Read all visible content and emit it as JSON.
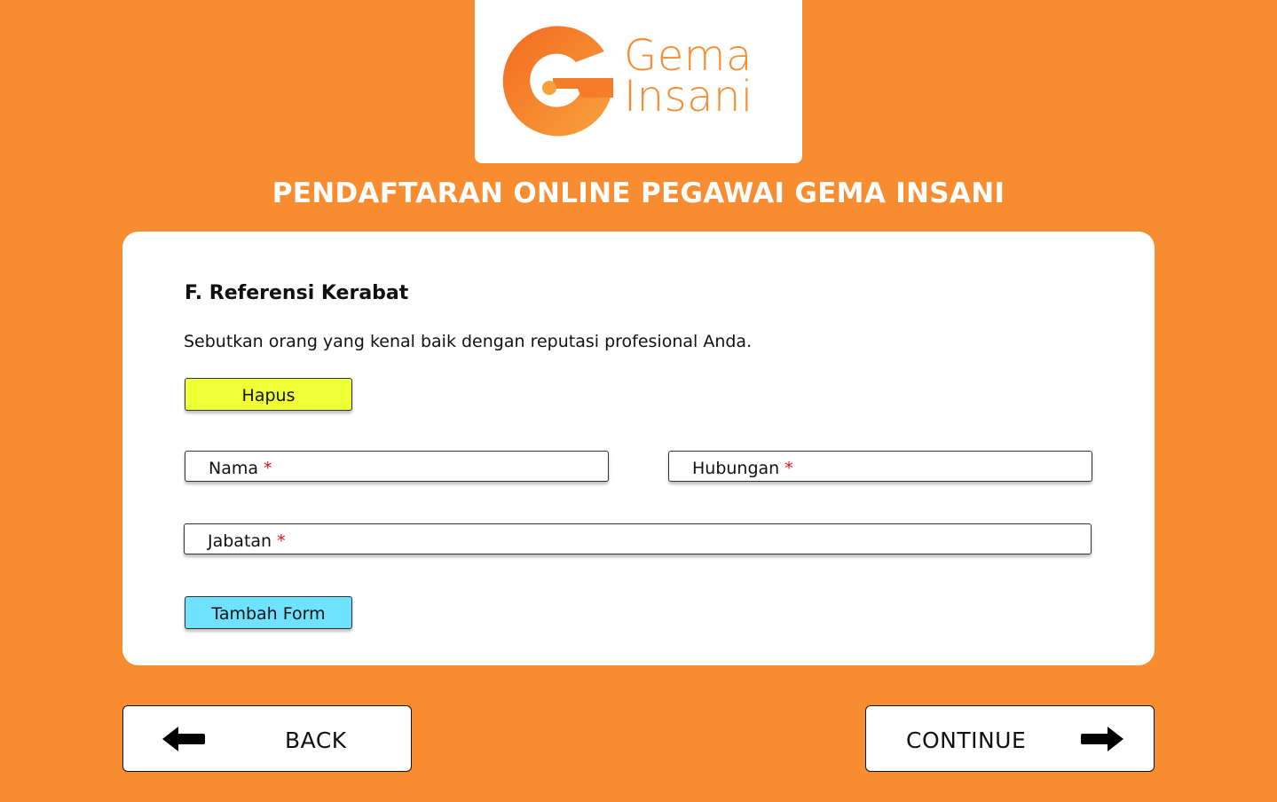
{
  "brand": {
    "name_line1": "Gema",
    "name_line2": "Insani",
    "color": "#F78C31"
  },
  "header": {
    "title": "PENDAFTARAN ONLINE PEGAWAI GEMA INSANI"
  },
  "form": {
    "section_title": "F. Referensi Kerabat",
    "description": "Sebutkan orang yang kenal baik dengan reputasi profesional Anda.",
    "delete_label": "Hapus",
    "delete_color": "#EEFF36",
    "fields": {
      "nama": "Nama",
      "hubungan": "Hubungan",
      "jabatan": "Jabatan",
      "required_marker": "*"
    },
    "add_form_label": "Tambah Form",
    "add_form_color": "#6FE2FF"
  },
  "nav": {
    "back_label": "BACK",
    "back_icon": "arrow-left-icon",
    "continue_label": "CONTINUE",
    "continue_icon": "arrow-right-icon"
  }
}
